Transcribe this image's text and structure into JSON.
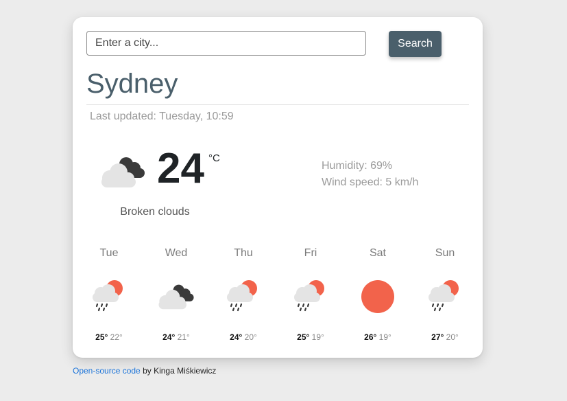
{
  "search": {
    "placeholder": "Enter a city...",
    "value": "",
    "button_label": "Search"
  },
  "current": {
    "city": "Sydney",
    "last_updated": "Last updated: Tuesday, 10:59",
    "temperature": "24",
    "unit": "°C",
    "description": "Broken clouds",
    "icon": "broken-clouds-icon",
    "humidity": "Humidity: 69%",
    "wind": "Wind speed: 5 km/h"
  },
  "forecast": [
    {
      "day": "Tue",
      "max": "25°",
      "min": "22°",
      "icon": "rain-sun-icon"
    },
    {
      "day": "Wed",
      "max": "24°",
      "min": "21°",
      "icon": "broken-clouds-icon"
    },
    {
      "day": "Thu",
      "max": "24°",
      "min": "20°",
      "icon": "rain-sun-icon"
    },
    {
      "day": "Fri",
      "max": "25°",
      "min": "19°",
      "icon": "rain-sun-icon"
    },
    {
      "day": "Sat",
      "max": "26°",
      "min": "19°",
      "icon": "sun-icon"
    },
    {
      "day": "Sun",
      "max": "27°",
      "min": "20°",
      "icon": "rain-sun-icon"
    }
  ],
  "footer": {
    "link_text": "Open-source code",
    "author_text": " by Kinga Miśkiewicz"
  },
  "colors": {
    "accent": "#4a5f6b",
    "sun": "#f2634b",
    "dark_cloud": "#3a3a3a",
    "light_cloud": "#e4e4e4",
    "link": "#1a73d9"
  }
}
